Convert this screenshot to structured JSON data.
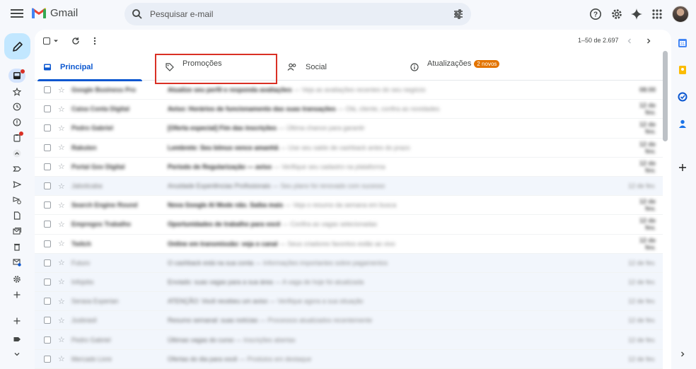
{
  "app": {
    "name": "Gmail"
  },
  "search": {
    "placeholder": "Pesquisar e-mail"
  },
  "toolbar": {
    "range": "1–50 de 2.697"
  },
  "tabs": [
    {
      "label": "Principal",
      "active": true
    },
    {
      "label": "Promoções",
      "active": false
    },
    {
      "label": "Social",
      "active": false
    },
    {
      "label": "Atualizações",
      "active": false,
      "badge": "2 novos"
    }
  ],
  "colors": {
    "accent": "#0b57d0",
    "highlight": "#d93025",
    "compose": "#c2e7ff",
    "badge": "#e37400"
  },
  "emails": [
    {
      "sender": "Google Business Pro",
      "subject": "Atualize seu perfil e responda avaliações",
      "snippet": " — Veja as avaliações recentes do seu negócio",
      "date": "08:00",
      "read": false
    },
    {
      "sender": "Caixa Conta Digital",
      "subject": "Aviso: Horários de funcionamento das suas transações",
      "snippet": " — Olá, cliente, confira as novidades",
      "date": "12 de fev.",
      "read": false
    },
    {
      "sender": "Pedro Gabriel",
      "subject": "[Oferta especial] Fim das inscrições",
      "snippet": " — Última chance para garantir",
      "date": "12 de fev.",
      "read": false
    },
    {
      "sender": "Rakuten",
      "subject": "Lembrete: Seu bônus vence amanhã",
      "snippet": " — Use seu saldo de cashback antes do prazo",
      "date": "12 de fev.",
      "read": false
    },
    {
      "sender": "Portal Gov Digital",
      "subject": "Período de Regularização — aviso",
      "snippet": " — Verifique seu cadastro na plataforma",
      "date": "12 de fev.",
      "read": false
    },
    {
      "sender": "Jaboticaba",
      "subject": "Anuidade Experiências Profissionais",
      "snippet": " — Seu plano foi renovado com sucesso",
      "date": "12 de fev.",
      "read": true
    },
    {
      "sender": "Search Engine Round",
      "subject": "Nova Google AI Mode não. Saiba mais",
      "snippet": " — Veja o resumo da semana em busca",
      "date": "12 de fev.",
      "read": false
    },
    {
      "sender": "Empregos Trabalho",
      "subject": "Oportunidades de trabalho para você",
      "snippet": " — Confira as vagas selecionadas",
      "date": "12 de fev.",
      "read": false
    },
    {
      "sender": "Twitch",
      "subject": "Online em transmissão: veja o canal",
      "snippet": " — Seus criadores favoritos estão ao vivo",
      "date": "12 de fev.",
      "read": false
    },
    {
      "sender": "Futuro",
      "subject": "O cashback está na sua conta",
      "snippet": " — Informações importantes sobre pagamentos",
      "date": "12 de fev.",
      "read": true
    },
    {
      "sender": "Infojobs",
      "subject": "Enviado: suas vagas para a sua área",
      "snippet": " — A vaga de hoje foi atualizada",
      "date": "12 de fev.",
      "read": true
    },
    {
      "sender": "Serasa Experian",
      "subject": "ATENÇÃO: Você recebeu um aviso",
      "snippet": " — Verifique agora a sua situação",
      "date": "12 de fev.",
      "read": true
    },
    {
      "sender": "Jusbrasil",
      "subject": "Resumo semanal: suas notícias",
      "snippet": " — Processos atualizados recentemente",
      "date": "12 de fev.",
      "read": true
    },
    {
      "sender": "Pedro Gabriel",
      "subject": "Últimas vagas do curso",
      "snippet": " — Inscrições abertas",
      "date": "12 de fev.",
      "read": true
    },
    {
      "sender": "Mercado Livre",
      "subject": "Ofertas do dia para você",
      "snippet": " — Produtos em destaque",
      "date": "12 de fev.",
      "read": true
    }
  ]
}
